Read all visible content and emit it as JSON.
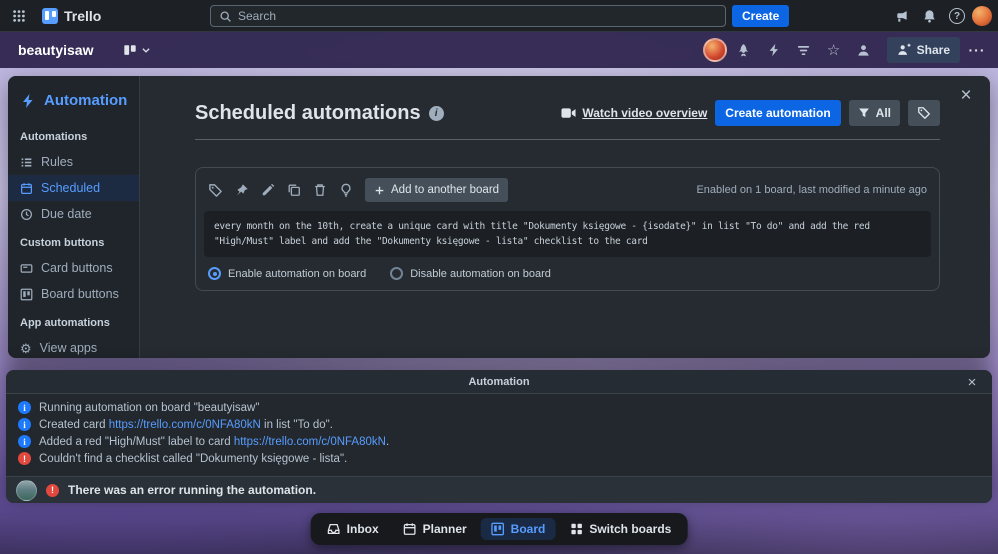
{
  "topbar": {
    "brand": "Trello",
    "search_placeholder": "Search",
    "create_button": "Create"
  },
  "board_header": {
    "board_name": "beautyisaw",
    "share_button": "Share"
  },
  "automation": {
    "sidebar": {
      "title": "Automation",
      "section_automations": "Automations",
      "rules": "Rules",
      "scheduled": "Scheduled",
      "due_date": "Due date",
      "section_custom": "Custom buttons",
      "card_buttons": "Card buttons",
      "board_buttons": "Board buttons",
      "section_apps": "App automations",
      "view_apps": "View apps"
    },
    "main": {
      "title": "Scheduled automations",
      "watch_video": "Watch video overview",
      "create_automation": "Create automation",
      "filter_all": "All",
      "card": {
        "add_to_board": "Add to another board",
        "status": "Enabled on 1 board, last modified a minute ago",
        "command": "every month on the 10th, create a unique card with title \"Dokumenty księgowe - {isodate}\" in list \"To do\" and add the red \"High/Must\" label and add the \"Dokumenty księgowe - lista\" checklist to the card",
        "enable": "Enable automation on board",
        "disable": "Disable automation on board"
      }
    }
  },
  "log": {
    "title": "Automation",
    "entries": [
      {
        "type": "info",
        "pre": "Running automation on board \"beautyisaw\"",
        "link": "",
        "post": ""
      },
      {
        "type": "info",
        "pre": "Created card ",
        "link": "https://trello.com/c/0NFA80kN",
        "post": " in list \"To do\"."
      },
      {
        "type": "info",
        "pre": "Added a red \"High/Must\" label to card ",
        "link": "https://trello.com/c/0NFA80kN",
        "post": "."
      },
      {
        "type": "error",
        "pre": "Couldn't find a checklist called \"Dokumenty księgowe - lista\".",
        "link": "",
        "post": ""
      }
    ],
    "footer": "There was an error running the automation."
  },
  "bottom_nav": {
    "inbox": "Inbox",
    "planner": "Planner",
    "board": "Board",
    "switch_boards": "Switch boards"
  },
  "colors": {
    "accent_blue": "#579dff",
    "primary_button_blue": "#0c66e4",
    "info_blue": "#1d7afc",
    "error_red": "#e2483d"
  }
}
